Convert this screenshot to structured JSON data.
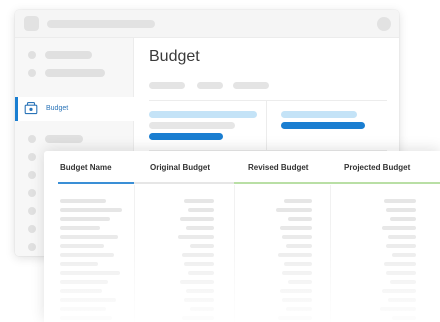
{
  "sidebar": {
    "active_item": {
      "label": "Budget",
      "icon": "budget-icon"
    }
  },
  "main": {
    "title": "Budget"
  },
  "table": {
    "columns": [
      {
        "label": "Budget Name",
        "underline_color": "#3a8fd6"
      },
      {
        "label": "Original Budget",
        "underline_color": "#e6e6e6"
      },
      {
        "label": "Revised Budget",
        "underline_color": "#b9dfa5"
      },
      {
        "label": "Projected Budget",
        "underline_color": "#b9dfa5"
      }
    ]
  },
  "colors": {
    "accent": "#1a7ed1",
    "accent_light": "#c4e3f7",
    "placeholder": "#e4e4e4"
  }
}
